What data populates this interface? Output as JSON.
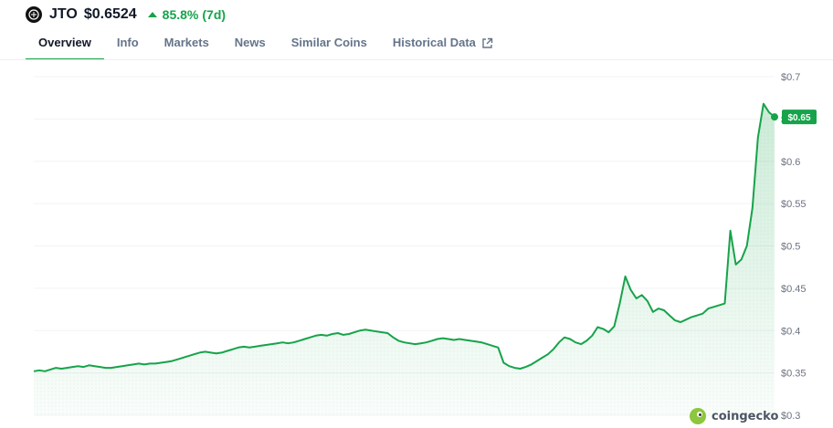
{
  "coin": {
    "logo_icon": "jito-logo-icon",
    "symbol": "JTO",
    "price": "$0.6524",
    "change_percent": "85.8%",
    "change_period": "(7d)",
    "change_direction": "up",
    "change_color": "#16a34a"
  },
  "tabs": [
    {
      "label": "Overview",
      "active": true
    },
    {
      "label": "Info",
      "active": false
    },
    {
      "label": "Markets",
      "active": false
    },
    {
      "label": "News",
      "active": false
    },
    {
      "label": "Similar Coins",
      "active": false
    },
    {
      "label": "Historical Data",
      "active": false,
      "icon": "external-link-icon"
    }
  ],
  "watermark": {
    "text": "coingecko",
    "icon": "coingecko-logo-icon"
  },
  "chart_data": {
    "type": "area",
    "title": "",
    "xlabel": "",
    "ylabel": "",
    "ylim": [
      0.3,
      0.7
    ],
    "yticks": [
      "$0.3",
      "$0.35",
      "$0.4",
      "$0.45",
      "$0.5",
      "$0.55",
      "$0.6",
      "$0.65",
      "$0.7"
    ],
    "ytick_values": [
      0.3,
      0.35,
      0.4,
      0.45,
      0.5,
      0.55,
      0.6,
      0.65,
      0.7
    ],
    "grid": true,
    "line_color": "#16a34a",
    "current_label": "$0.65",
    "current_value": 0.6524,
    "series": [
      {
        "values": [
          0.352,
          0.353,
          0.352,
          0.354,
          0.356,
          0.355,
          0.356,
          0.357,
          0.358,
          0.357,
          0.359,
          0.358,
          0.357,
          0.356,
          0.356,
          0.357,
          0.358,
          0.359,
          0.36,
          0.361,
          0.36,
          0.361,
          0.361,
          0.362,
          0.363,
          0.364,
          0.366,
          0.368,
          0.37,
          0.372,
          0.374,
          0.375,
          0.374,
          0.373,
          0.374,
          0.376,
          0.378,
          0.38,
          0.381,
          0.38,
          0.381,
          0.382,
          0.383,
          0.384,
          0.385,
          0.386,
          0.385,
          0.386,
          0.388,
          0.39,
          0.392,
          0.394,
          0.395,
          0.394,
          0.396,
          0.397,
          0.395,
          0.396,
          0.398,
          0.4,
          0.401,
          0.4,
          0.399,
          0.398,
          0.397,
          0.392,
          0.388,
          0.386,
          0.385,
          0.384,
          0.385,
          0.386,
          0.388,
          0.39,
          0.391,
          0.39,
          0.389,
          0.39,
          0.389,
          0.388,
          0.387,
          0.386,
          0.384,
          0.382,
          0.38,
          0.362,
          0.358,
          0.356,
          0.355,
          0.357,
          0.36,
          0.364,
          0.368,
          0.372,
          0.378,
          0.386,
          0.392,
          0.39,
          0.386,
          0.384,
          0.388,
          0.394,
          0.404,
          0.402,
          0.398,
          0.405,
          0.432,
          0.464,
          0.448,
          0.438,
          0.442,
          0.435,
          0.422,
          0.426,
          0.424,
          0.418,
          0.412,
          0.41,
          0.413,
          0.416,
          0.418,
          0.42,
          0.426,
          0.428,
          0.43,
          0.432,
          0.518,
          0.478,
          0.484,
          0.5,
          0.545,
          0.628,
          0.668,
          0.658,
          0.6524
        ]
      }
    ]
  }
}
